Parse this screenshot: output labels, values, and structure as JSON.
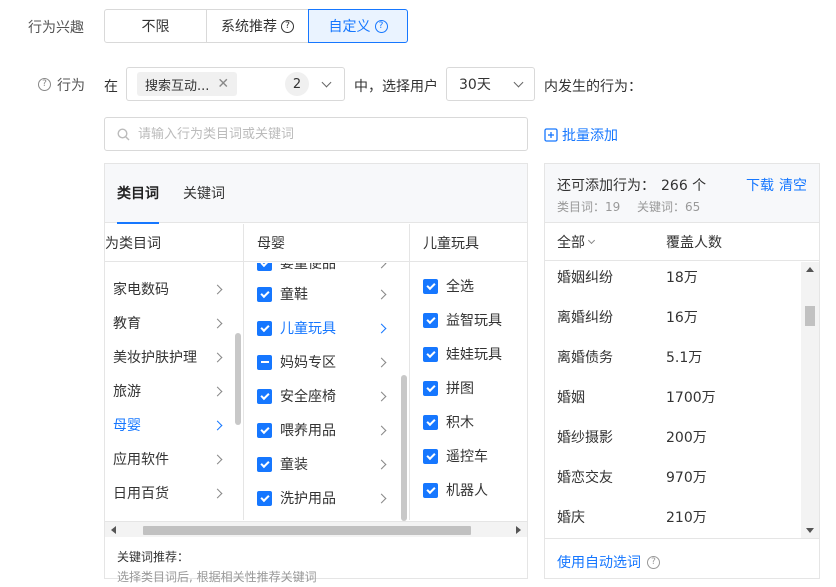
{
  "interest": {
    "label": "行为兴趣",
    "options": [
      "不限",
      "系统推荐",
      "自定义"
    ]
  },
  "behavior": {
    "label": "行为",
    "in_text": "在",
    "tag": "搜索互动...",
    "count": "2",
    "middle_text": "中，选择用户",
    "days": "30天",
    "suffix": "内发生的行为："
  },
  "search": {
    "placeholder": "请输入行为类目词或关键词",
    "batch_add": "批量添加"
  },
  "tabs": [
    "类目词",
    "关键词"
  ],
  "columns": {
    "col1_header": "为类目词",
    "col2_header": "母婴",
    "col3_header": "儿童玩具",
    "col1_items": [
      "家电数码",
      "教育",
      "美妆护肤护理",
      "旅游",
      "母婴",
      "应用软件",
      "日用百货"
    ],
    "col2_partial": "婴童便品",
    "col2_items": [
      "童鞋",
      "儿童玩具",
      "妈妈专区",
      "安全座椅",
      "喂养用品",
      "童装",
      "洗护用品"
    ],
    "col3_items": [
      "全选",
      "益智玩具",
      "娃娃玩具",
      "拼图",
      "积木",
      "遥控车",
      "机器人"
    ]
  },
  "keyword_recommend": {
    "title": "关键词推荐：",
    "hint": "选择类目词后, 根据相关性推荐关键词"
  },
  "right": {
    "remaining_label": "还可添加行为：",
    "remaining_count": "266 个",
    "category_count": "类目词：19",
    "keyword_count": "关键词：65",
    "download": "下载",
    "clear": "清空",
    "header_all": "全部",
    "header_cover": "覆盖人数",
    "rows": [
      {
        "name": "婚姻纠纷",
        "value": "18万"
      },
      {
        "name": "离婚纠纷",
        "value": "16万"
      },
      {
        "name": "离婚债务",
        "value": "5.1万"
      },
      {
        "name": "婚姻",
        "value": "1700万"
      },
      {
        "name": "婚纱摄影",
        "value": "200万"
      },
      {
        "name": "婚恋交友",
        "value": "970万"
      },
      {
        "name": "婚庆",
        "value": "210万"
      }
    ],
    "auto_select": "使用自动选词"
  },
  "colors": {
    "accent": "#1677ff"
  }
}
